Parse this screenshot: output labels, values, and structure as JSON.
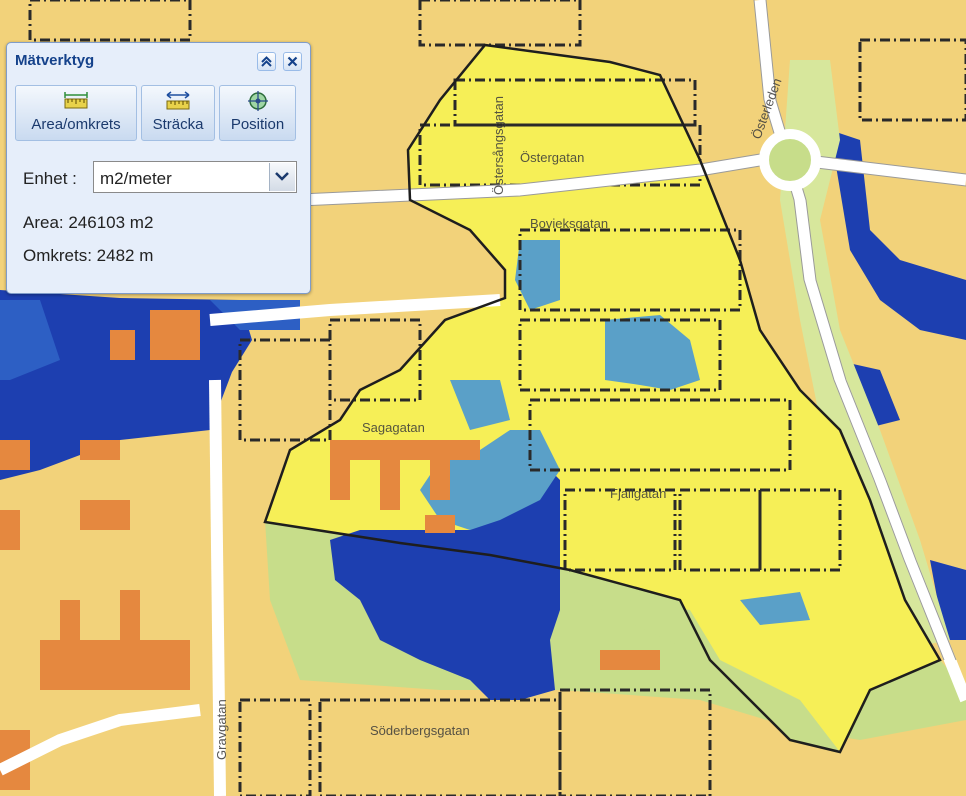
{
  "map": {
    "street_labels": [
      "Östergatan",
      "Österleden",
      "Bovieksgatan",
      "Fjallgatan",
      "Sagagatan",
      "Gravgatan",
      "Söderbergsgatan",
      "Östersångsgatan"
    ]
  },
  "colors": {
    "residential": "#f2d27a",
    "selected_area": "#f6ef57",
    "building": "#e5883f",
    "park": "#c7dd8a",
    "flood_deep": "#1d3fb0",
    "flood_shallow": "#5aa0c8",
    "outline": "#1e1e1e"
  },
  "tool": {
    "title": "Mätverktyg",
    "collapse_icon": "double-chevron-up-icon",
    "close_icon": "close-icon",
    "buttons": [
      {
        "label": "Area/omkrets",
        "icon": "ruler-area-icon"
      },
      {
        "label": "Sträcka",
        "icon": "ruler-distance-icon"
      },
      {
        "label": "Position",
        "icon": "crosshair-position-icon"
      }
    ],
    "unit_label": "Enhet :",
    "unit_value": "m2/meter",
    "area_text": "Area: 246103 m2",
    "perimeter_text": "Omkrets: 2482 m"
  }
}
